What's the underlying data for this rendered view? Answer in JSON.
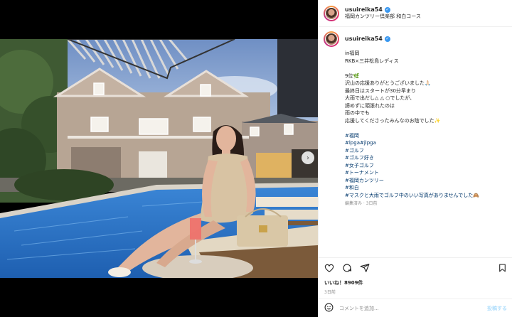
{
  "account": {
    "username": "usuireika54",
    "location": "福岡カンツリー倶楽部 和白コース"
  },
  "caption": {
    "lines": [
      "in福岡",
      "RKB×三井松島レディス",
      "",
      "9位🌿",
      "沢山の応援ありがとうございました🙏🏻",
      "最終日はスタートが30分早まり",
      "大雨で出だし△ △ ○でしたが、",
      "諦めずに頑張れたのは",
      "雨の中でも",
      "応援してくださったみんなのお陰でした✨",
      "",
      "#福岡",
      "#lpga#jlpga",
      "#ゴルフ",
      "#ゴルフ好き",
      "#女子ゴルフ",
      "#トーナメント",
      "#福岡カンツリー",
      "#和白",
      "#マスクと大雨でゴルフ中のいい写真がありませんでした🙈"
    ],
    "edited": "編集済み · 3日前"
  },
  "post": {
    "likes": "いいね！8909件",
    "timestamp": "3日前"
  },
  "comment": {
    "placeholder": "コメントを追加...",
    "post_label": "投稿する"
  },
  "icons": {
    "like": "heart-icon",
    "comment": "comment-icon",
    "share": "share-icon",
    "save": "bookmark-icon",
    "emoji": "emoji-icon",
    "next": "chevron-right-icon",
    "verified": "verified-badge-icon"
  },
  "colors": {
    "verified": "#3897f0",
    "hashtag": "#00376b",
    "muted": "#8e8e8e",
    "post_button": "#b2dffc"
  }
}
